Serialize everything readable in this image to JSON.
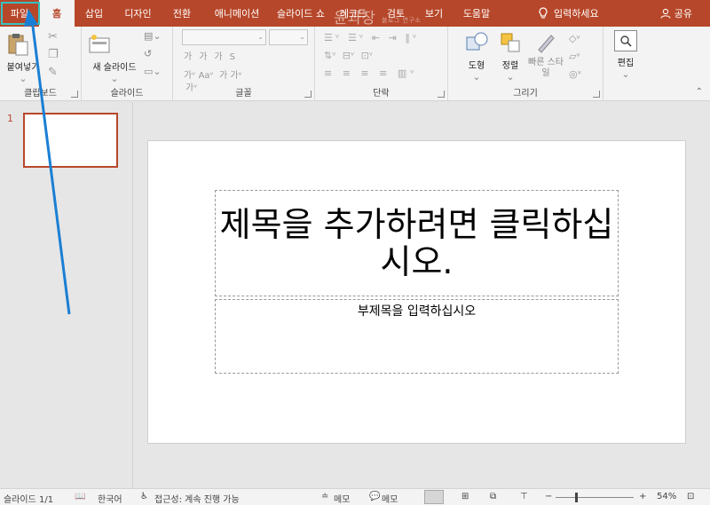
{
  "tabs": {
    "file": "파일",
    "home": "홈",
    "insert": "삽입",
    "design": "디자인",
    "transitions": "전환",
    "animations": "애니메이션",
    "slideshow": "슬라이드 쇼",
    "record": "레코드",
    "review": "검토",
    "view": "보기",
    "help": "도움말",
    "tell_me": "입력하세요",
    "share": "공유"
  },
  "watermark": {
    "main": "윤과장",
    "sub": "블로그 연구소"
  },
  "ribbon": {
    "clipboard": {
      "paste": "붙여넣기",
      "label": "클립보드"
    },
    "slides": {
      "new_slide": "새 슬라이드",
      "label": "슬라이드"
    },
    "font": {
      "label": "글꼴",
      "aa": "Aa",
      "ga": "가"
    },
    "paragraph": {
      "label": "단락"
    },
    "drawing": {
      "shape": "도형",
      "arrange": "정렬",
      "quick_styles": "빠른 스타일",
      "label": "그리기"
    },
    "editing": {
      "edit": "편집"
    }
  },
  "thumbnails": [
    {
      "number": "1"
    }
  ],
  "slide": {
    "title_placeholder": "제목을 추가하려면 클릭하십시오.",
    "subtitle_placeholder": "부제목을 입력하십시오"
  },
  "statusbar": {
    "slide_count": "슬라이드 1/1",
    "language": "한국어",
    "accessibility": "접근성: 계속 진행 가능",
    "notes": "메모",
    "comments": "메모",
    "zoom": "54%"
  },
  "colors": {
    "accent": "#b7472a",
    "highlight": "#36c2c2",
    "annotation_arrow": "#1a7fd4"
  }
}
